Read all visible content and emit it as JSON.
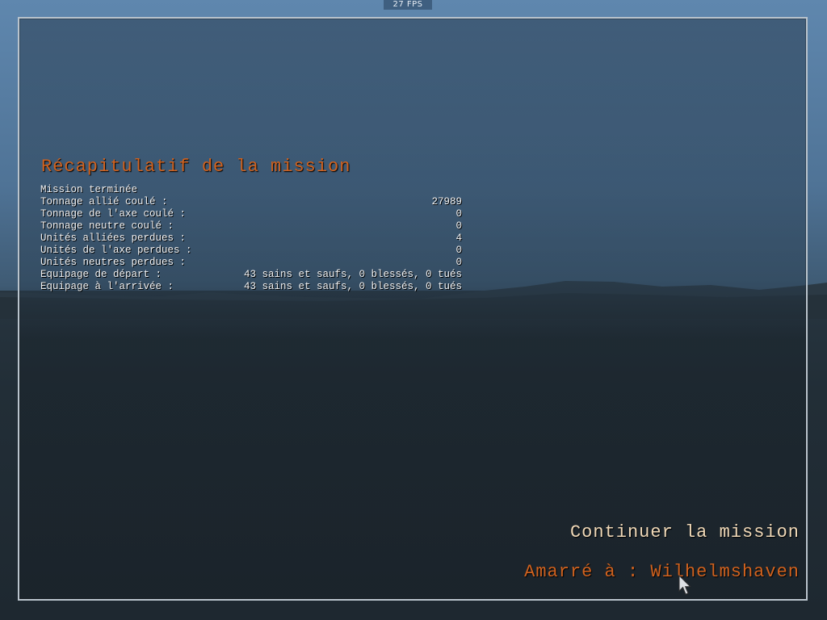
{
  "hud": {
    "fps": "27 FPS"
  },
  "summary": {
    "title": "Récapitulatif de la mission",
    "rows": [
      {
        "label": "Mission terminée",
        "value": ""
      },
      {
        "label": "Tonnage allié coulé :",
        "value": "27989"
      },
      {
        "label": "Tonnage de l'axe coulé :",
        "value": "0"
      },
      {
        "label": "Tonnage neutre coulé :",
        "value": "0"
      },
      {
        "label": "Unités alliées perdues :",
        "value": "4"
      },
      {
        "label": "Unités de l'axe perdues :",
        "value": "0"
      },
      {
        "label": "Unités neutres perdues :",
        "value": "0"
      },
      {
        "label": "Equipage de départ :",
        "value": "43 sains et saufs,  0 blessés,  0 tués"
      },
      {
        "label": "Equipage à l'arrivée :",
        "value": "43 sains et saufs,  0 blessés,  0 tués"
      }
    ]
  },
  "actions": {
    "continue_label": "Continuer la mission",
    "docked_label": "Amarré à : Wilhelmshaven"
  },
  "icons": {
    "cursor": "arrow-cursor-icon"
  },
  "colors": {
    "accent": "#d0621f",
    "continue": "#f0d9b8",
    "text": "#f2f2f2"
  }
}
